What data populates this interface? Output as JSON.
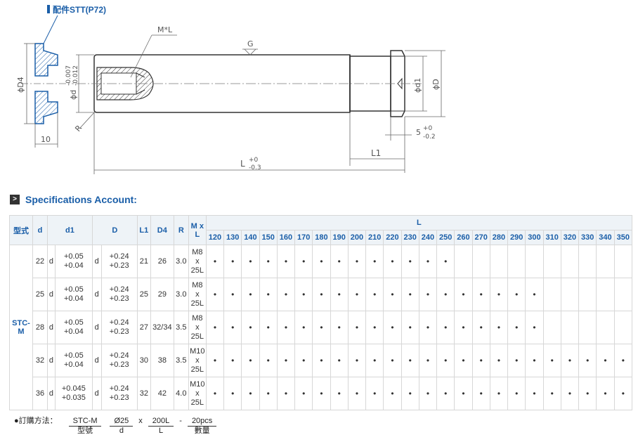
{
  "drawing": {
    "accessory_label": "配件STT(P72)",
    "dim_D4": "ϕD4",
    "dim_10": "10",
    "dim_d_base": "ϕd",
    "dim_d_tol_upper": "-0.007",
    "dim_d_tol_lower": "-0.012",
    "dim_R": "R",
    "dim_ML": "M*L",
    "dim_G": "G",
    "dim_d1": "ϕd1",
    "dim_D": "ϕD",
    "dim_5": "5",
    "dim_5_tol_upper": "+0",
    "dim_5_tol_lower": "-0.2",
    "dim_L1": "L1",
    "dim_L": "L",
    "dim_L_tol_upper": "+0",
    "dim_L_tol_lower": "-0.3"
  },
  "spec_title": "Specifications Account:",
  "spec_icon": "arrow-right-icon",
  "table": {
    "headers": {
      "model": "型式",
      "d": "d",
      "d1": "d1",
      "D": "D",
      "L1": "L1",
      "D4": "D4",
      "R": "R",
      "ML": "M x L",
      "L": "L"
    },
    "L_values": [
      "120",
      "130",
      "140",
      "150",
      "160",
      "170",
      "180",
      "190",
      "200",
      "210",
      "220",
      "230",
      "240",
      "250",
      "260",
      "270",
      "280",
      "290",
      "300",
      "310",
      "320",
      "330",
      "340",
      "350"
    ],
    "model": "STC-M",
    "rows": [
      {
        "d": "22",
        "d_sym": "d",
        "d1_up": "+0.05",
        "d1_lo": "+0.04",
        "D_sym": "d",
        "D_up": "+0.24",
        "D_lo": "+0.23",
        "L1": "21",
        "D4": "26",
        "R": "3.0",
        "M1": "M8",
        "M2": "x",
        "M3": "25L",
        "avail": [
          1,
          1,
          1,
          1,
          1,
          1,
          1,
          1,
          1,
          1,
          1,
          1,
          1,
          1,
          0,
          0,
          0,
          0,
          0,
          0,
          0,
          0,
          0,
          0
        ]
      },
      {
        "d": "25",
        "d_sym": "d",
        "d1_up": "+0.05",
        "d1_lo": "+0.04",
        "D_sym": "d",
        "D_up": "+0.24",
        "D_lo": "+0.23",
        "L1": "25",
        "D4": "29",
        "R": "3.0",
        "M1": "M8",
        "M2": "x",
        "M3": "25L",
        "avail": [
          1,
          1,
          1,
          1,
          1,
          1,
          1,
          1,
          1,
          1,
          1,
          1,
          1,
          1,
          1,
          1,
          1,
          1,
          1,
          0,
          0,
          0,
          0,
          0
        ]
      },
      {
        "d": "28",
        "d_sym": "d",
        "d1_up": "+0.05",
        "d1_lo": "+0.04",
        "D_sym": "d",
        "D_up": "+0.24",
        "D_lo": "+0.23",
        "L1": "27",
        "D4": "32/34",
        "R": "3.5",
        "M1": "M8",
        "M2": "x",
        "M3": "25L",
        "avail": [
          1,
          1,
          1,
          1,
          1,
          1,
          1,
          1,
          1,
          1,
          1,
          1,
          1,
          1,
          1,
          1,
          1,
          1,
          1,
          0,
          0,
          0,
          0,
          0
        ]
      },
      {
        "d": "32",
        "d_sym": "d",
        "d1_up": "+0.05",
        "d1_lo": "+0.04",
        "D_sym": "d",
        "D_up": "+0.24",
        "D_lo": "+0.23",
        "L1": "30",
        "D4": "38",
        "R": "3.5",
        "M1": "M10",
        "M2": "x",
        "M3": "25L",
        "avail": [
          1,
          1,
          1,
          1,
          1,
          1,
          1,
          1,
          1,
          1,
          1,
          1,
          1,
          1,
          1,
          1,
          1,
          1,
          1,
          1,
          1,
          1,
          1,
          1
        ]
      },
      {
        "d": "36",
        "d_sym": "d",
        "d1_up": "+0.045",
        "d1_lo": "+0.035",
        "D_sym": "d",
        "D_up": "+0.24",
        "D_lo": "+0.23",
        "L1": "32",
        "D4": "42",
        "R": "4.0",
        "M1": "M10",
        "M2": "x",
        "M3": "25L",
        "avail": [
          1,
          1,
          1,
          1,
          1,
          1,
          1,
          1,
          1,
          1,
          1,
          1,
          1,
          1,
          1,
          1,
          1,
          1,
          1,
          1,
          1,
          1,
          1,
          1
        ]
      }
    ],
    "dot": "•"
  },
  "order": {
    "label": "●訂購方法：",
    "parts": [
      {
        "top": "STC-M",
        "bottom": "型號"
      },
      {
        "top": "Ø25",
        "bottom": "d"
      },
      {
        "top": "200L",
        "bottom": "L"
      },
      {
        "top": "20pcs",
        "bottom": "數量"
      }
    ],
    "sep1": "x",
    "sep2": "-"
  }
}
